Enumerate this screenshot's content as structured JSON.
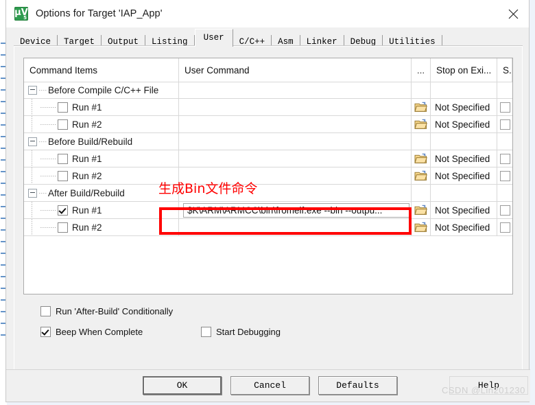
{
  "window": {
    "title": "Options for Target 'IAP_App'",
    "icon": "keil-uvision-icon",
    "close_label": "close-icon"
  },
  "tabs": [
    {
      "label": "Device",
      "active": false
    },
    {
      "label": "Target",
      "active": false
    },
    {
      "label": "Output",
      "active": false
    },
    {
      "label": "Listing",
      "active": false
    },
    {
      "label": "User",
      "active": true
    },
    {
      "label": "C/C++",
      "active": false
    },
    {
      "label": "Asm",
      "active": false
    },
    {
      "label": "Linker",
      "active": false
    },
    {
      "label": "Debug",
      "active": false
    },
    {
      "label": "Utilities",
      "active": false
    }
  ],
  "list": {
    "headers": {
      "command_items": "Command Items",
      "user_command": "User Command",
      "dots": "...",
      "stop_on_exit": "Stop on Exi...",
      "s": "S..."
    },
    "rows": [
      {
        "kind": "group",
        "label": "Before Compile C/C++ File",
        "command": "",
        "has_folder": false,
        "stop_on_exit": "",
        "has_s_checkbox": false,
        "checked": false
      },
      {
        "kind": "child",
        "label": "Run #1",
        "command": "",
        "has_folder": true,
        "stop_on_exit": "Not Specified",
        "has_s_checkbox": true,
        "checked": false
      },
      {
        "kind": "child",
        "label": "Run #2",
        "command": "",
        "has_folder": true,
        "stop_on_exit": "Not Specified",
        "has_s_checkbox": true,
        "checked": false
      },
      {
        "kind": "group",
        "label": "Before Build/Rebuild",
        "command": "",
        "has_folder": false,
        "stop_on_exit": "",
        "has_s_checkbox": false,
        "checked": false
      },
      {
        "kind": "child",
        "label": "Run #1",
        "command": "",
        "has_folder": true,
        "stop_on_exit": "Not Specified",
        "has_s_checkbox": true,
        "checked": false
      },
      {
        "kind": "child",
        "label": "Run #2",
        "command": "",
        "has_folder": true,
        "stop_on_exit": "Not Specified",
        "has_s_checkbox": true,
        "checked": false
      },
      {
        "kind": "group",
        "label": "After Build/Rebuild",
        "command": "",
        "has_folder": false,
        "stop_on_exit": "",
        "has_s_checkbox": false,
        "checked": false
      },
      {
        "kind": "child",
        "label": "Run #1",
        "command": "$K\\ARM\\ARMCC\\bin\\fromelf.exe --bin --outpu...",
        "has_folder": true,
        "stop_on_exit": "Not Specified",
        "has_s_checkbox": true,
        "checked": true,
        "editing": true
      },
      {
        "kind": "child",
        "label": "Run #2",
        "command": "",
        "has_folder": true,
        "stop_on_exit": "Not Specified",
        "has_s_checkbox": true,
        "checked": false
      }
    ]
  },
  "options": {
    "run_after_build_conditionally": {
      "label": "Run 'After-Build' Conditionally",
      "checked": false
    },
    "beep_when_complete": {
      "label": "Beep When Complete",
      "checked": true
    },
    "start_debugging": {
      "label": "Start Debugging",
      "checked": false
    }
  },
  "footer": {
    "ok": "OK",
    "cancel": "Cancel",
    "defaults": "Defaults",
    "help": "Help"
  },
  "annotations": {
    "note": "生成Bin文件命令",
    "note_color": "#ff0000",
    "highlight_color": "#ff0000"
  },
  "watermark": "CSDN @Lin201230"
}
